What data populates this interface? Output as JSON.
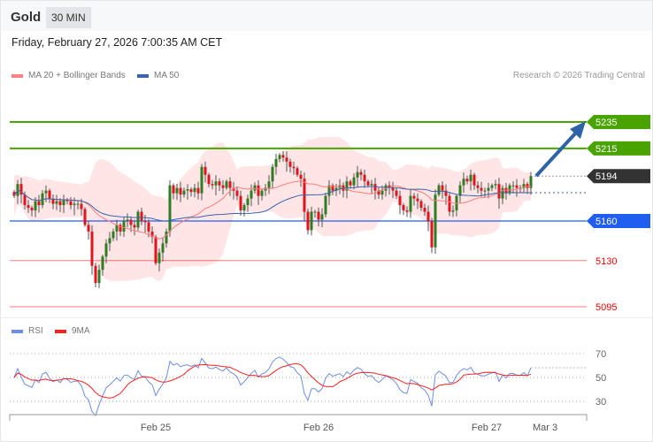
{
  "header": {
    "title": "Gold",
    "timeframe": "30 MIN",
    "datetime": "Friday, February 27, 2026 7:00:35 AM CET"
  },
  "legend": {
    "ma20": "MA 20 + Bollinger Bands",
    "ma50": "MA 50",
    "rsi": "RSI",
    "rsi_ma": "9MA"
  },
  "credit": "Research © 2026 Trading Central",
  "colors": {
    "up": "#2e7d22",
    "down": "#e0141e",
    "ma20": "#ff7a7a",
    "ma50": "#3a64a8",
    "band": "#ffe1e1",
    "resistance": "#49a300",
    "current": "#333333",
    "support": "#1f5ef0",
    "support2": "#ff2020",
    "rsi": "#6b8ee8",
    "rsi_ma": "#ff1e1e"
  },
  "chart_data": {
    "type": "candlestick",
    "title": "Gold 30 MIN",
    "closes": [
      5179,
      5188,
      5180,
      5172,
      5170,
      5168,
      5175,
      5172,
      5181,
      5183,
      5177,
      5173,
      5175,
      5172,
      5176,
      5175,
      5172,
      5173,
      5173,
      5169,
      5157,
      5152,
      5126,
      5113,
      5123,
      5133,
      5143,
      5147,
      5152,
      5157,
      5152,
      5160,
      5161,
      5157,
      5155,
      5167,
      5160,
      5159,
      5152,
      5148,
      5128,
      5136,
      5143,
      5152,
      5187,
      5181,
      5185,
      5180,
      5183,
      5184,
      5182,
      5185,
      5181,
      5201,
      5195,
      5188,
      5187,
      5190,
      5187,
      5185,
      5190,
      5185,
      5183,
      5179,
      5168,
      5172,
      5177,
      5183,
      5187,
      5179,
      5183,
      5185,
      5190,
      5201,
      5207,
      5210,
      5208,
      5205,
      5201,
      5200,
      5195,
      5192,
      5167,
      5153,
      5167,
      5167,
      5161,
      5165,
      5179,
      5187,
      5183,
      5185,
      5187,
      5183,
      5190,
      5187,
      5193,
      5197,
      5195,
      5190,
      5187,
      5188,
      5183,
      5180,
      5183,
      5187,
      5185,
      5183,
      5179,
      5172,
      5168,
      5167,
      5179,
      5177,
      5175,
      5170,
      5167,
      5160,
      5140,
      5180,
      5187,
      5183,
      5179,
      5167,
      5168,
      5179,
      5187,
      5192,
      5190,
      5195,
      5187,
      5185,
      5183,
      5183,
      5185,
      5187,
      5188,
      5177,
      5185,
      5181,
      5187,
      5187,
      5185,
      5185,
      5188,
      5185,
      5194
    ],
    "price_levels": [
      {
        "label": "5235",
        "value": 5235,
        "kind": "resistance"
      },
      {
        "label": "5215",
        "value": 5215,
        "kind": "resistance"
      },
      {
        "label": "5194",
        "value": 5194,
        "kind": "current"
      },
      {
        "label": "5160",
        "value": 5160,
        "kind": "support"
      },
      {
        "label": "5130",
        "value": 5130,
        "kind": "support2"
      },
      {
        "label": "5095",
        "value": 5095,
        "kind": "support2"
      }
    ],
    "x_labels": [
      {
        "label": "Feb 25",
        "index": 40
      },
      {
        "label": "Feb 26",
        "index": 86
      },
      {
        "label": "Feb 27",
        "index": 133.5
      },
      {
        "label": "Mar 3",
        "index": 150
      }
    ],
    "rsi_ticks": [
      {
        "label": "70",
        "value": 70
      },
      {
        "label": "50",
        "value": 50
      },
      {
        "label": "30",
        "value": 30
      }
    ],
    "ylim": [
      5095,
      5235
    ],
    "rsi_ylim": [
      30,
      70
    ],
    "forecast": "up"
  }
}
